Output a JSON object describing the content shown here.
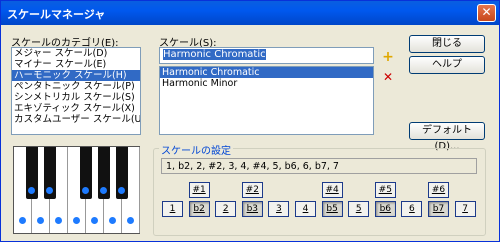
{
  "window": {
    "title": "スケールマネージャ",
    "close": "✕"
  },
  "category": {
    "label": "スケールのカテゴリ(E):",
    "items": [
      "メジャー スケール(D)",
      "マイナー スケール(E)",
      "ハーモニック スケール(H)",
      "ペンタトニック スケール(P)",
      "シンメトリカル スケール(S)",
      "エキゾティック スケール(X)",
      "カスタムユーザー スケール(U)"
    ],
    "selected_index": 2
  },
  "scale": {
    "label": "スケール(S):",
    "value": "Harmonic Chromatic",
    "items": [
      "Harmonic Chromatic",
      "Harmonic Minor"
    ],
    "selected_index": 0
  },
  "buttons": {
    "close": "閉じる",
    "help": "ヘルプ",
    "default": "デフォルト(D)...",
    "add": "+",
    "remove": "✕"
  },
  "settings": {
    "title": "スケールの設定",
    "notes_text": "1, b2, 2, #2, 3, 4, #4, 5, b6, 6, b7, 7",
    "sharps": [
      "#1",
      "#2",
      "#4",
      "#5",
      "#6"
    ],
    "naturals": [
      "1",
      "b2",
      "2",
      "b3",
      "3",
      "4",
      "b5",
      "5",
      "b6",
      "6",
      "b7",
      "7"
    ],
    "pressed": [
      "b2",
      "b3",
      "b5",
      "b6",
      "b7"
    ]
  },
  "colors": {
    "accent": "#316ac5",
    "title_bar": "#0058ee",
    "group_title": "#0046d5",
    "note_dot": "#1e7bff"
  },
  "icons": {
    "add": "plus-icon",
    "remove": "cross-icon"
  }
}
